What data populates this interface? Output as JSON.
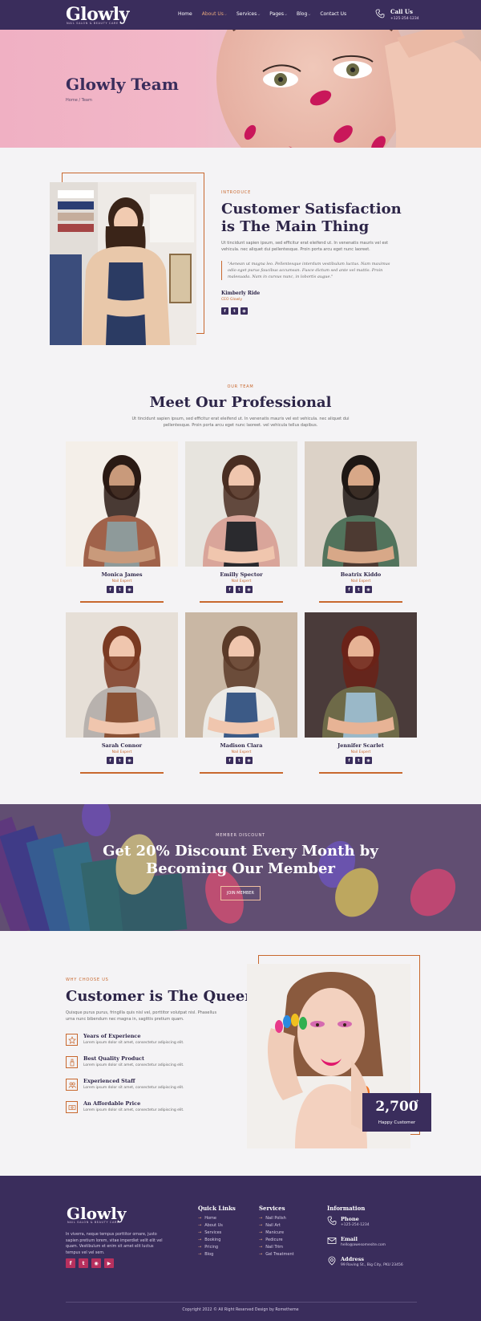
{
  "header": {
    "logo": "Glowly",
    "logo_tagline": "NAIL SALON & BEAUTY CARE",
    "nav": [
      {
        "label": "Home",
        "dropdown": false,
        "active": false
      },
      {
        "label": "About Us",
        "dropdown": true,
        "active": true
      },
      {
        "label": "Services",
        "dropdown": true,
        "active": false
      },
      {
        "label": "Pages",
        "dropdown": true,
        "active": false
      },
      {
        "label": "Blog",
        "dropdown": true,
        "active": false
      },
      {
        "label": "Contact Us",
        "dropdown": false,
        "active": false
      }
    ],
    "call_label": "Call Us",
    "call_number": "+125-254-1234"
  },
  "hero": {
    "title": "Glowly Team",
    "breadcrumb": "Home / Team"
  },
  "intro": {
    "eyebrow": "INTRODUCE",
    "heading_line1": "Customer Satisfaction",
    "heading_line2": "is The Main Thing",
    "paragraph": "Ut tincidunt sapien ipsum, sed efficitur erat eleifend ut. In venenatis mauris vel est vehicula. nec aliquet dui pellentesque. Proin porta arcu eget nunc laoreet.",
    "quote": "\"Aenean ut magna leo. Pellentesque interdum vestibulum luctus. Nam maximus odio eget purus faucibus accumsan. Fusce dictum sed ante vel mattis. Proin malesuada. Nam in cursus nunc, in lobortis augue.\"",
    "author_name": "Kimberly Ride",
    "author_role": "CEO Glowly",
    "social": [
      "f",
      "t",
      "ig"
    ]
  },
  "team": {
    "eyebrow": "OUR TEAM",
    "heading": "Meet Our Professional",
    "paragraph": "Ut tincidunt sapien ipsum, sed efficitur erat eleifend ut. In venenatis mauris vel est vehicula. nec aliquet dui pellentesque. Proin porta arcu eget nunc laoreet. vel vehicula tellus dapibus.",
    "members": [
      {
        "name": "Monica James",
        "role": "Nail Expert"
      },
      {
        "name": "Emilly Spector",
        "role": "Nail Expert"
      },
      {
        "name": "Beatrix Kiddo",
        "role": "Nail Expert"
      },
      {
        "name": "Sarah Connor",
        "role": "Nail Expert"
      },
      {
        "name": "Madison Clara",
        "role": "Nail Expert"
      },
      {
        "name": "Jennifer Scarlet",
        "role": "Nail Expert"
      }
    ]
  },
  "discount": {
    "eyebrow": "MEMBER DISCOUNT",
    "heading_line1": "Get 20% Discount Every Month by",
    "heading_line2": "Becoming Our Member",
    "button": "JOIN MEMBER"
  },
  "why": {
    "eyebrow": "WHY CHOOSE US",
    "heading": "Customer is The Queen",
    "paragraph": "Quisque purus purus, fringilla quis nisl vel, porttitor volutpat nisl. Phasellus urna nunc bibendum nec magna in, sagittis pretium quam.",
    "features": [
      {
        "title": "Years of Experience",
        "desc": "Lorem ipsum dolor sit amet, consectetur adipiscing elit.",
        "icon": "star-badge-icon"
      },
      {
        "title": "Best Quality Product",
        "desc": "Lorem ipsum dolor sit amet, consectetur adipiscing elit.",
        "icon": "nail-polish-icon"
      },
      {
        "title": "Experienced Staff",
        "desc": "Lorem ipsum dolor sit amet, consectetur adipiscing elit.",
        "icon": "staff-icon"
      },
      {
        "title": "An Affordable Price",
        "desc": "Lorem ipsum dolor sit amet, consectetur adipiscing elit.",
        "icon": "price-tag-icon"
      }
    ],
    "stat_number": "2,700",
    "stat_plus": "+",
    "stat_label": "Happy Customer"
  },
  "footer": {
    "logo": "Glowly",
    "logo_tagline": "NAIL SALON & BEAUTY CARE",
    "about": "In viverra, neque tempus porttitor ornare, justo sapien pretium lorem, vitae imperdiet velit elit vel quam. Vestibulum et enim sit amet elit luctus tempus vel vel sem.",
    "social": [
      "f",
      "t",
      "ig",
      "yt"
    ],
    "quick_links_title": "Quick Links",
    "quick_links": [
      "Home",
      "About Us",
      "Services",
      "Booking",
      "Pricing",
      "Blog"
    ],
    "services_title": "Services",
    "services": [
      "Nail Polish",
      "Nail Art",
      "Manicure",
      "Pedicure",
      "Nail Trim",
      "Gel Treatment"
    ],
    "info_title": "Information",
    "phone_label": "Phone",
    "phone": "+125-254-1234",
    "email_label": "Email",
    "email": "hello@awesomesite.com",
    "address_label": "Address",
    "address": "99 Roving St., Big City, PKU 23456",
    "copyright": "Copyright 2022 © All Right Reserved Design by Rometheme"
  },
  "colors": {
    "brand_purple": "#3a2d5c",
    "accent_orange": "#c8682e",
    "social_pink": "#b7305e",
    "hero_pink": "#f0b0c3"
  }
}
